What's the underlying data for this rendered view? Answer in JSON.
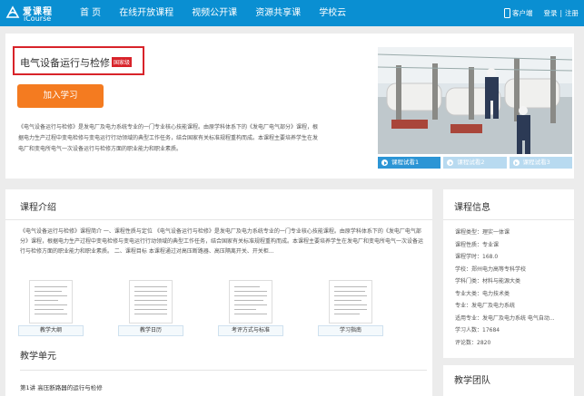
{
  "header": {
    "logo_cn": "爱课程",
    "logo_en": "iCourse",
    "nav": [
      "首 页",
      "在线开放课程",
      "视频公开课",
      "资源共享课",
      "学校云"
    ],
    "client_label": "客户端",
    "login": "登录",
    "separator": "|",
    "register": "注册"
  },
  "course": {
    "title": "电气设备运行与检修",
    "badge": "国家级",
    "join_button": "加入学习",
    "description": "《电气设备运行与检修》是发电厂及电力系统专业的一门专业核心技能课程。由原学科体系下的《发电厂电气部分》课程，根据电力生产过程中变电检修与变电运行行动领域的典型工作任务，结合国家有关标准规程重构而成。本课程主要培养学生在发电厂和变电所电气一次设备运行与检修方面的职业能力和职业素质。",
    "trials": [
      "课程试看1",
      "课程试看2",
      "课程试看3"
    ]
  },
  "intro": {
    "title": "课程介绍",
    "text": "《电气设备运行与检修》课程简介 一、课程性质与定位 《电气设备运行与检修》是发电厂及电力系统专业的一门专业核心技能课程。由原学科体系下的《发电厂电气部分》课程，根据电力生产过程中变电检修与变电运行行动领域的典型工作任务，结合国家有关标准规程重构而成。本课程主要培养学生在发电厂和变电所电气一次设备运行与检修方面的职业能力和职业素质。 二、课程目标 本课程通过对高压断路器、高压隔离开关、开关柜...",
    "docs": [
      "教学大纲",
      "教学日历",
      "考评方式与标准",
      "学习指南"
    ],
    "unit_title": "教学单元",
    "unit_first": "第1讲 高压断路器的运行与检修"
  },
  "info": {
    "title": "课程信息",
    "rows": [
      "课程类型：理实一体课",
      "课程性质：专业课",
      "课程学时：168.0",
      "学校：郑州电力高等专科学校",
      "学科门类：材料与能源大类",
      "专业大类：电力技术类",
      "专业：发电厂及电力系统",
      "适用专业：发电厂及电力系统 电气自动...",
      "学习人数：17684",
      "评论数：2820"
    ],
    "team_title": "教学团队"
  }
}
